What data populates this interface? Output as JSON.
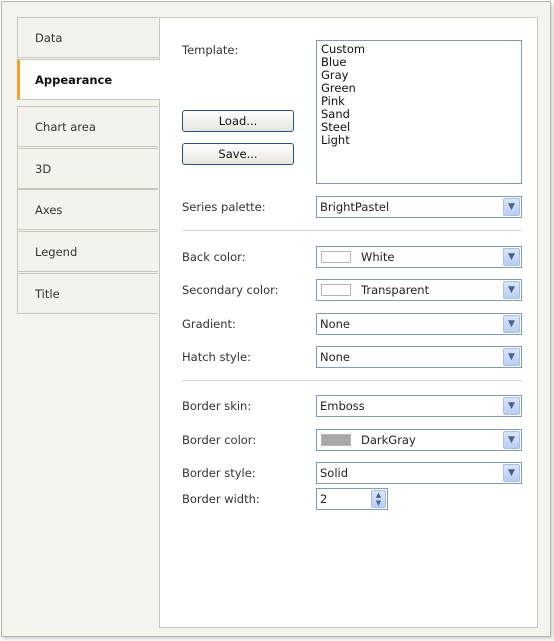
{
  "tabs": [
    "Data",
    "Appearance",
    "Chart area",
    "3D",
    "Axes",
    "Legend",
    "Title"
  ],
  "active_tab": "Appearance",
  "template": {
    "label": "Template:",
    "items": [
      "Custom",
      "Blue",
      "Gray",
      "Green",
      "Pink",
      "Sand",
      "Steel",
      "Light"
    ]
  },
  "buttons": {
    "load": "Load...",
    "save": "Save..."
  },
  "series_palette": {
    "label": "Series palette:",
    "value": "BrightPastel"
  },
  "back_color": {
    "label": "Back color:",
    "value": "White",
    "swatch": "#ffffff"
  },
  "secondary_color": {
    "label": "Secondary color:",
    "value": "Transparent",
    "swatch": "#ffffff"
  },
  "gradient": {
    "label": "Gradient:",
    "value": "None"
  },
  "hatch_style": {
    "label": "Hatch style:",
    "value": "None"
  },
  "border_skin": {
    "label": "Border skin:",
    "value": "Emboss"
  },
  "border_color": {
    "label": "Border color:",
    "value": "DarkGray",
    "swatch": "#a9a9a9"
  },
  "border_style": {
    "label": "Border style:",
    "value": "Solid"
  },
  "border_width": {
    "label": "Border width:",
    "value": "2"
  },
  "icons": {
    "dropdown": "chevron-down-icon",
    "spin": "spin-up-down-icon"
  }
}
